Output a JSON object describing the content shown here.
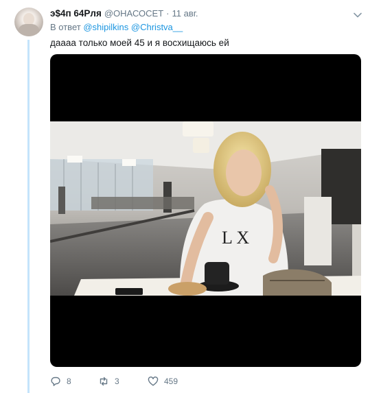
{
  "tweet": {
    "display_name": "э$4п 64Рля",
    "handle": "@ОНАСОСЕТ",
    "separator": "·",
    "timestamp": "11 авг.",
    "reply_prefix": "В ответ",
    "mentions": [
      "@shipilkins",
      "@Christva__"
    ],
    "text": "даааа только моей 45 и я восхищаюсь ей",
    "media": {
      "type": "photo",
      "description_icon": "photo"
    },
    "actions": {
      "reply_count": "8",
      "retweet_count": "3",
      "like_count": "459"
    }
  },
  "colors": {
    "accent": "#1b95e0",
    "muted": "#657786",
    "thread_line": "#c4e4fb",
    "media_bg": "#000000"
  },
  "icons": {
    "caret": "chevron-down-icon",
    "reply": "reply-icon",
    "retweet": "retweet-icon",
    "like": "heart-icon"
  }
}
